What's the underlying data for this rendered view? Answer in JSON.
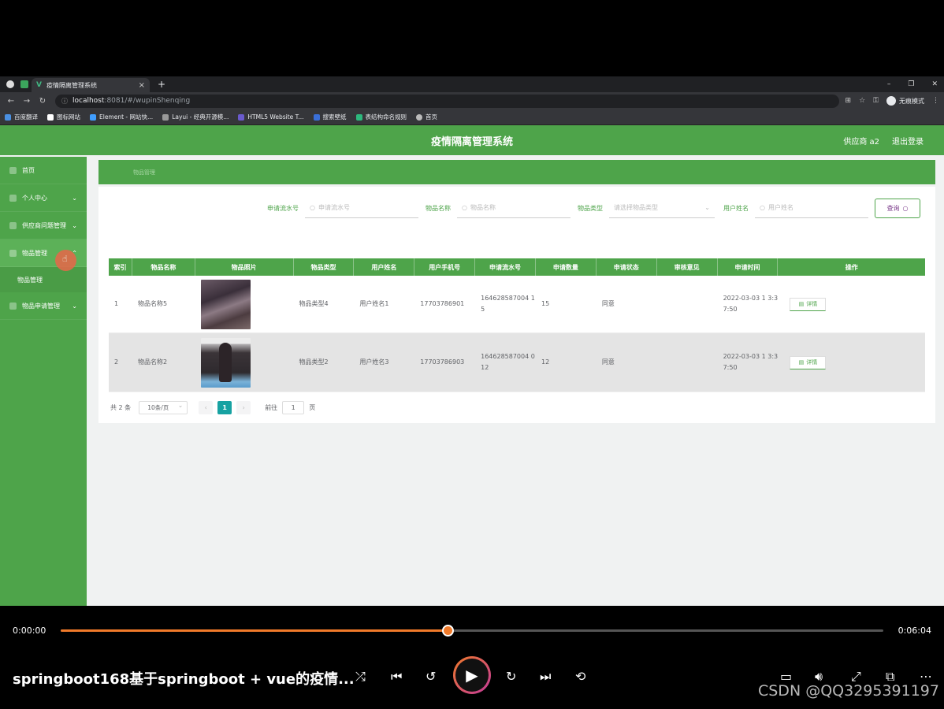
{
  "browser": {
    "tab_title": "疫情隔离管理系统",
    "url_host": "localhost",
    "url_path": ":8081/#/wupinShenqing",
    "profile_label": "无痕模式",
    "bookmarks": [
      "百度翻译",
      "图标网站",
      "Element - 网站快...",
      "Layui - 经典开源模...",
      "HTML5 Website T...",
      "搜索壁纸",
      "表结构命名规则",
      "首页"
    ]
  },
  "app": {
    "title": "疫情隔离管理系统",
    "user_label": "供应商 a2",
    "logout_label": "退出登录"
  },
  "sidebar": {
    "items": [
      {
        "label": "首页"
      },
      {
        "label": "个人中心"
      },
      {
        "label": "供应商问题管理"
      },
      {
        "label": "物品管理"
      },
      {
        "label": "物品申请管理"
      }
    ],
    "submenu_label": "物品管理"
  },
  "breadcrumb": "物品管理",
  "search": {
    "serial_label": "申请流水号",
    "serial_placeholder": "申请流水号",
    "name_label": "物品名称",
    "name_placeholder": "物品名称",
    "type_label": "物品类型",
    "type_placeholder": "请选择物品类型",
    "user_label": "用户姓名",
    "user_placeholder": "用户姓名",
    "query_label": "查询"
  },
  "table": {
    "headers": [
      "索引",
      "物品名称",
      "物品照片",
      "物品类型",
      "用户姓名",
      "用户手机号",
      "申请流水号",
      "申请数量",
      "申请状态",
      "审核意见",
      "申请时间",
      "操作"
    ],
    "rows": [
      {
        "index": "1",
        "name": "物品名称5",
        "type": "物品类型4",
        "user": "用户姓名1",
        "phone": "17703786901",
        "serial": "164628587004 15",
        "qty": "15",
        "status": "同意",
        "review": "",
        "time": "2022-03-03 1 3:37:50",
        "action": "详情"
      },
      {
        "index": "2",
        "name": "物品名称2",
        "type": "物品类型2",
        "user": "用户姓名3",
        "phone": "17703786903",
        "serial": "164628587004 012",
        "qty": "12",
        "status": "同意",
        "review": "",
        "time": "2022-03-03 1 3:37:50",
        "action": "详情"
      }
    ]
  },
  "pager": {
    "total": "共 2 条",
    "page_size": "10条/页",
    "current": "1",
    "goto_label": "前往",
    "goto_value": "1",
    "page_unit": "页"
  },
  "player": {
    "current_time": "0:00:00",
    "total_time": "0:06:04",
    "progress": 0.47,
    "title": "springboot168基于springboot + vue的疫情...",
    "watermark": "CSDN @QQ3295391197"
  },
  "colors": {
    "brand_green": "#4ea44a",
    "accent_orange": "#f07a2a",
    "page_active": "#17a2a2"
  }
}
